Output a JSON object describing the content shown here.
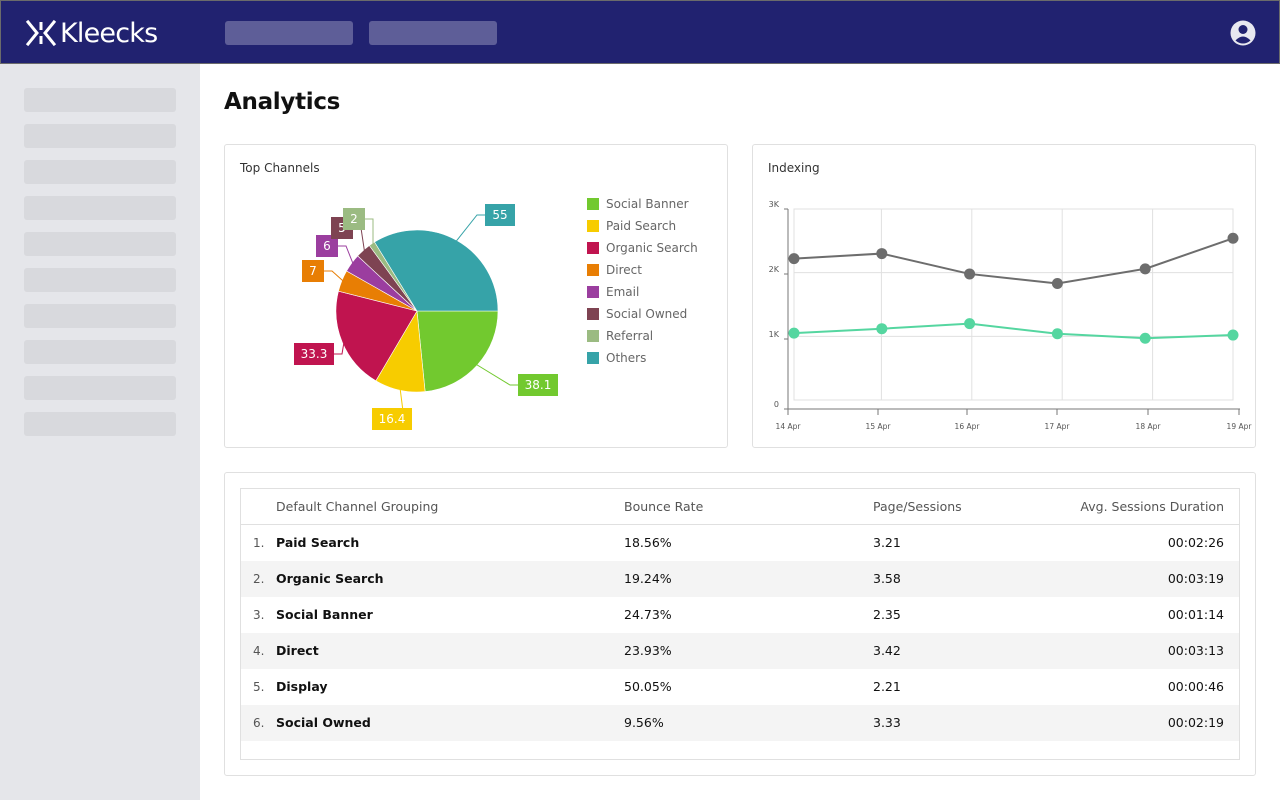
{
  "header": {
    "brand": "Kleecks",
    "brand_color": "#212270",
    "nav_placeholders": 2,
    "user_icon": "user-circle-icon"
  },
  "sidebar": {
    "placeholder_count": 10
  },
  "page": {
    "title": "Analytics"
  },
  "top_channels": {
    "title": "Top Channels",
    "chart_data": {
      "type": "pie",
      "title": "Top Channels",
      "start": "3 o'clock, clockwise",
      "legend_placement": "right",
      "slices": [
        {
          "label": "Social Banner",
          "value": 38.1,
          "display": "38.1",
          "color": "#72c92f"
        },
        {
          "label": "Paid Search",
          "value": 16.4,
          "display": "16.4",
          "color": "#f7cc00"
        },
        {
          "label": "Organic Search",
          "value": 33.3,
          "display": "33.3",
          "color": "#c0144f"
        },
        {
          "label": "Direct",
          "value": 7,
          "display": "7",
          "color": "#e87e04"
        },
        {
          "label": "Email",
          "value": 6,
          "display": "6",
          "color": "#9b3e9f"
        },
        {
          "label": "Social Owned",
          "value": 5,
          "display": "5",
          "color": "#7e4352"
        },
        {
          "label": "Referral",
          "value": 2,
          "display": "2",
          "color": "#9bbb82"
        },
        {
          "label": "Others",
          "value": 55,
          "display": "55",
          "color": "#36a3a8"
        }
      ]
    }
  },
  "indexing": {
    "title": "Indexing",
    "chart_data": {
      "type": "line",
      "title": "Indexing",
      "x": [
        "14 Apr",
        "15 Apr",
        "16 Apr",
        "17 Apr",
        "18 Apr",
        "19 Apr"
      ],
      "y_ticks": [
        "0",
        "1K",
        "2K",
        "3K"
      ],
      "ylim": [
        0,
        3000
      ],
      "grid": true,
      "series": [
        {
          "name": "series-gray",
          "color": "#6d6d6d",
          "values": [
            2220,
            2300,
            1980,
            1830,
            2060,
            2540
          ]
        },
        {
          "name": "series-green",
          "color": "#55d6a0",
          "values": [
            1050,
            1120,
            1200,
            1040,
            970,
            1020
          ]
        }
      ]
    }
  },
  "table": {
    "columns": [
      "Default Channel Grouping",
      "Bounce Rate",
      "Page/Sessions",
      "Avg. Sessions Duration"
    ],
    "rows": [
      {
        "num": "1.",
        "name": "Paid Search",
        "bounce": "18.56%",
        "pages": "3.21",
        "duration": "00:02:26"
      },
      {
        "num": "2.",
        "name": "Organic Search",
        "bounce": "19.24%",
        "pages": "3.58",
        "duration": "00:03:19"
      },
      {
        "num": "3.",
        "name": "Social Banner",
        "bounce": "24.73%",
        "pages": "2.35",
        "duration": "00:01:14"
      },
      {
        "num": "4.",
        "name": "Direct",
        "bounce": "23.93%",
        "pages": "3.42",
        "duration": "00:03:13"
      },
      {
        "num": "5.",
        "name": "Display",
        "bounce": "50.05%",
        "pages": "2.21",
        "duration": "00:00:46"
      },
      {
        "num": "6.",
        "name": "Social Owned",
        "bounce": "9.56%",
        "pages": "3.33",
        "duration": "00:02:19"
      }
    ]
  }
}
